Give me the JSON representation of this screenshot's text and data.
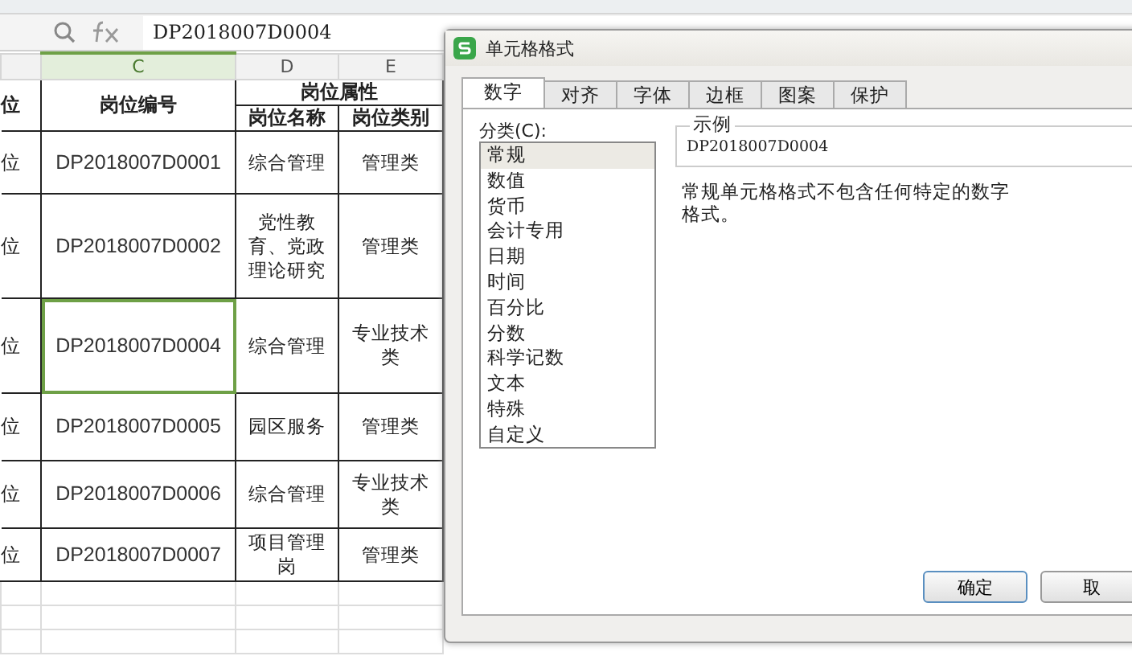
{
  "formula_bar": {
    "value": "DP2018007D0004"
  },
  "columns": [
    {
      "label": "C",
      "selected": true
    },
    {
      "label": "D",
      "selected": false
    },
    {
      "label": "E",
      "selected": false
    }
  ],
  "header": {
    "col_b": "位",
    "col_c": "岗位编号",
    "group": "岗位属性",
    "col_d": "岗位名称",
    "col_e": "岗位类别"
  },
  "rows": [
    {
      "b": "位",
      "c": "DP2018007D0001",
      "d": "综合管理",
      "e": "管理类",
      "selected": false
    },
    {
      "b": "位",
      "c": "DP2018007D0002",
      "d": "党性教育、党政理论研究",
      "e": "管理类",
      "selected": false
    },
    {
      "b": "位",
      "c": "DP2018007D0004",
      "d": "综合管理",
      "e": "专业技术类",
      "selected": true
    },
    {
      "b": "位",
      "c": "DP2018007D0005",
      "d": "园区服务",
      "e": "管理类",
      "selected": false
    },
    {
      "b": "位",
      "c": "DP2018007D0006",
      "d": "综合管理",
      "e": "专业技术类",
      "selected": false
    },
    {
      "b": "位",
      "c": "DP2018007D0007",
      "d": "项目管理岗",
      "e": "管理类",
      "selected": false
    }
  ],
  "dialog": {
    "title": "单元格格式",
    "tabs": [
      {
        "label": "数字",
        "selected": true
      },
      {
        "label": "对齐",
        "selected": false
      },
      {
        "label": "字体",
        "selected": false
      },
      {
        "label": "边框",
        "selected": false
      },
      {
        "label": "图案",
        "selected": false
      },
      {
        "label": "保护",
        "selected": false
      }
    ],
    "category_label": "分类(C):",
    "categories": [
      {
        "label": "常规",
        "selected": true
      },
      {
        "label": "数值",
        "selected": false
      },
      {
        "label": "货币",
        "selected": false
      },
      {
        "label": "会计专用",
        "selected": false
      },
      {
        "label": "日期",
        "selected": false
      },
      {
        "label": "时间",
        "selected": false
      },
      {
        "label": "百分比",
        "selected": false
      },
      {
        "label": "分数",
        "selected": false
      },
      {
        "label": "科学记数",
        "selected": false
      },
      {
        "label": "文本",
        "selected": false
      },
      {
        "label": "特殊",
        "selected": false
      },
      {
        "label": "自定义",
        "selected": false
      }
    ],
    "sample_label": "示例",
    "sample_value": "DP2018007D0004",
    "description": "常规单元格格式不包含任何特定的数字格式。",
    "buttons": [
      "确定",
      "取"
    ]
  }
}
